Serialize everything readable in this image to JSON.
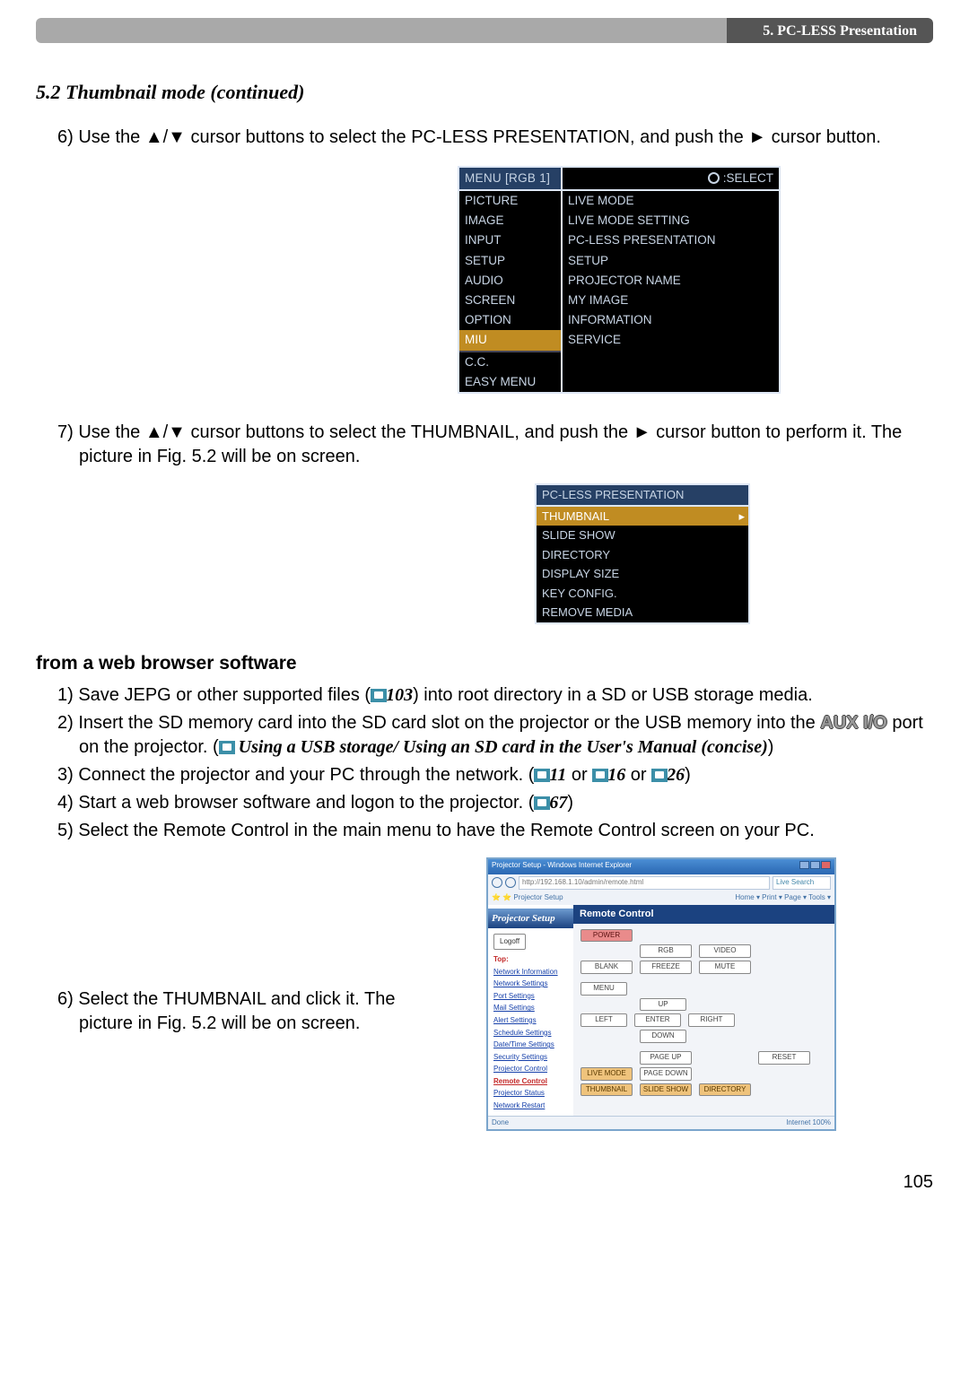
{
  "header": {
    "chapter": "5. PC-LESS Presentation"
  },
  "section_head": "5.2 Thumbnail mode (continued)",
  "step6": "6) Use the ▲/▼ cursor buttons to select the PC-LESS PRESENTATION, and push the ► cursor button.",
  "menu1": {
    "top_left": "MENU [RGB 1]",
    "top_right": ":SELECT",
    "col1": [
      "PICTURE",
      "IMAGE",
      "INPUT",
      "SETUP",
      "AUDIO",
      "SCREEN",
      "OPTION",
      "MIU",
      "C.C.",
      "EASY MENU"
    ],
    "col1_highlight_index": 7,
    "col1_sep_after_index": 7,
    "col2": [
      "LIVE MODE",
      "LIVE MODE SETTING",
      "PC-LESS PRESENTATION",
      "SETUP",
      "PROJECTOR NAME",
      "MY IMAGE",
      "INFORMATION",
      "SERVICE"
    ]
  },
  "step7": "7) Use the ▲/▼ cursor buttons to select the THUMBNAIL, and push the ► cursor button to perform it. The picture in Fig. 5.2 will be on screen.",
  "menu2": {
    "head": "PC-LESS PRESENTATION",
    "rows": [
      "THUMBNAIL",
      "SLIDE SHOW",
      "DIRECTORY",
      "DISPLAY SIZE",
      "KEY CONFIG.",
      "REMOVE MEDIA"
    ],
    "highlight_index": 0
  },
  "subhead": "from a web browser software",
  "wstep1a": "1) Save JEPG or other supported files (",
  "wref103": "103",
  "wstep1b": ") into root directory in a SD or USB storage media.",
  "wstep2a": "2) Insert the SD memory card into the SD card slot on the projector or the USB memory into the ",
  "aux": "AUX I/O",
  "wstep2b": " port on the projector. (",
  "wstep2_it": " Using a USB storage/ Using an SD card in the User's Manual (concise)",
  "wstep2c": ")",
  "wstep3a": "3) Connect the projector and your PC through the network. (",
  "wref11": "11",
  "or": " or ",
  "wref16": "16",
  "wref26": "26",
  "wstep3b": ")",
  "wstep4a": "4) Start a web browser software and logon to the projector. (",
  "wref67": "67",
  "wstep4b": ")",
  "wstep5": "5) Select the Remote Control in the main menu to have the Remote Control screen on your PC.",
  "wstep6": "6) Select the THUMBNAIL and click it. The picture in Fig. 5.2 will be on screen.",
  "browser": {
    "title": "Projector Setup - Windows Internet Explorer",
    "url": "http://192.168.1.10/admin/remote.html",
    "live": "Live Search",
    "tab": "Projector Setup",
    "tabright": "Home ▾  Print ▾  Page ▾  Tools ▾",
    "sidebar_title": "Projector Setup",
    "logoff": "Logoff",
    "top": "Top:",
    "nav": [
      "Network Information",
      "Network Settings",
      "Port Settings",
      "Mail Settings",
      "Alert Settings",
      "Schedule Settings",
      "Date/Time Settings",
      "Security Settings",
      "Projector Control",
      "Remote Control",
      "Projector Status",
      "Network Restart"
    ],
    "nav_red_index": 9,
    "pane_head": "Remote Control",
    "power": "POWER",
    "row2": [
      "RGB",
      "VIDEO"
    ],
    "row3": [
      "BLANK",
      "FREEZE",
      "MUTE"
    ],
    "menu": "MENU",
    "up": "UP",
    "leftr": [
      "LEFT",
      "ENTER",
      "RIGHT"
    ],
    "down": "DOWN",
    "pageup": "PAGE UP",
    "reset": "RESET",
    "row_orng1": [
      "LIVE MODE",
      "PAGE DOWN"
    ],
    "row_orng2": [
      "THUMBNAIL",
      "SLIDE SHOW",
      "DIRECTORY"
    ],
    "status_left": "Done",
    "status_right": "Internet    100%"
  },
  "pagenum": "105"
}
